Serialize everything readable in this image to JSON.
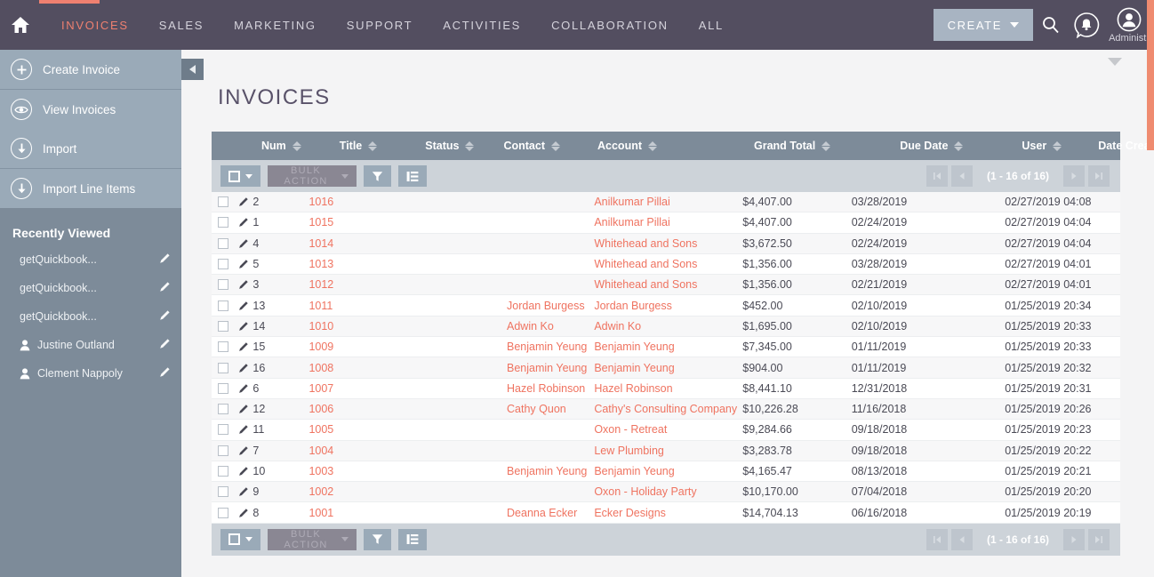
{
  "topnav": {
    "home_icon": "home-icon",
    "items": [
      {
        "label": "INVOICES",
        "active": true
      },
      {
        "label": "SALES",
        "active": false
      },
      {
        "label": "MARKETING",
        "active": false
      },
      {
        "label": "SUPPORT",
        "active": false
      },
      {
        "label": "ACTIVITIES",
        "active": false
      },
      {
        "label": "COLLABORATION",
        "active": false
      },
      {
        "label": "ALL",
        "active": false
      }
    ],
    "create_label": "CREATE",
    "search_icon": "search-icon",
    "notification_icon": "bell-icon",
    "user_icon": "user-avatar-icon",
    "user_name": "Administr"
  },
  "sidebar": {
    "actions": [
      {
        "label": "Create Invoice",
        "icon": "plus-circle-icon"
      },
      {
        "label": "View Invoices",
        "icon": "eye-circle-icon"
      },
      {
        "label": "Import",
        "icon": "download-circle-icon"
      },
      {
        "label": "Import Line Items",
        "icon": "download-circle-icon"
      }
    ],
    "recently_viewed_title": "Recently Viewed",
    "recent": [
      {
        "label": "getQuickbook...",
        "icon": null
      },
      {
        "label": "getQuickbook...",
        "icon": null
      },
      {
        "label": "getQuickbook...",
        "icon": null
      },
      {
        "label": "Justine Outland",
        "icon": "person-icon"
      },
      {
        "label": "Clement Nappoly",
        "icon": "person-icon"
      }
    ],
    "collapse_icon": "collapse-left-icon"
  },
  "main": {
    "title": "INVOICES",
    "toolbar": {
      "select_all_icon": "checkbox-dropdown-icon",
      "bulk_action_label": "BULK ACTION",
      "filter_icon": "funnel-icon",
      "columns_icon": "list-columns-icon"
    },
    "pagination": {
      "first_icon": "first-page-icon",
      "prev_icon": "prev-page-icon",
      "count_label": "(1 - 16 of 16)",
      "next_icon": "next-page-icon",
      "last_icon": "last-page-icon"
    },
    "columns": [
      {
        "key": "num",
        "label": "Num",
        "sorted": false
      },
      {
        "key": "title",
        "label": "Title",
        "sorted": false
      },
      {
        "key": "status",
        "label": "Status",
        "sorted": false
      },
      {
        "key": "contact",
        "label": "Contact",
        "sorted": false
      },
      {
        "key": "account",
        "label": "Account",
        "sorted": false
      },
      {
        "key": "grand_total",
        "label": "Grand Total",
        "sorted": false
      },
      {
        "key": "due_date",
        "label": "Due Date",
        "sorted": false
      },
      {
        "key": "user",
        "label": "User",
        "sorted": false
      },
      {
        "key": "date_created",
        "label": "Date Created",
        "sorted": true
      }
    ],
    "rows": [
      {
        "num": "2",
        "title": "1016",
        "status": "",
        "contact": "",
        "account": "Anilkumar Pillai",
        "grand_total": "$4,407.00",
        "due_date": "03/28/2019",
        "user": "",
        "date_created": "02/27/2019 04:08"
      },
      {
        "num": "1",
        "title": "1015",
        "status": "",
        "contact": "",
        "account": "Anilkumar Pillai",
        "grand_total": "$4,407.00",
        "due_date": "02/24/2019",
        "user": "",
        "date_created": "02/27/2019 04:04"
      },
      {
        "num": "4",
        "title": "1014",
        "status": "",
        "contact": "",
        "account": "Whitehead and Sons",
        "grand_total": "$3,672.50",
        "due_date": "02/24/2019",
        "user": "",
        "date_created": "02/27/2019 04:04"
      },
      {
        "num": "5",
        "title": "1013",
        "status": "",
        "contact": "",
        "account": "Whitehead and Sons",
        "grand_total": "$1,356.00",
        "due_date": "03/28/2019",
        "user": "",
        "date_created": "02/27/2019 04:01"
      },
      {
        "num": "3",
        "title": "1012",
        "status": "",
        "contact": "",
        "account": "Whitehead and Sons",
        "grand_total": "$1,356.00",
        "due_date": "02/21/2019",
        "user": "",
        "date_created": "02/27/2019 04:01"
      },
      {
        "num": "13",
        "title": "1011",
        "status": "",
        "contact": "Jordan Burgess",
        "account": "Jordan Burgess",
        "grand_total": "$452.00",
        "due_date": "02/10/2019",
        "user": "",
        "date_created": "01/25/2019 20:34"
      },
      {
        "num": "14",
        "title": "1010",
        "status": "",
        "contact": "Adwin Ko",
        "account": "Adwin Ko",
        "grand_total": "$1,695.00",
        "due_date": "02/10/2019",
        "user": "",
        "date_created": "01/25/2019 20:33"
      },
      {
        "num": "15",
        "title": "1009",
        "status": "",
        "contact": "Benjamin Yeung",
        "account": "Benjamin Yeung",
        "grand_total": "$7,345.00",
        "due_date": "01/11/2019",
        "user": "",
        "date_created": "01/25/2019 20:33"
      },
      {
        "num": "16",
        "title": "1008",
        "status": "",
        "contact": "Benjamin Yeung",
        "account": "Benjamin Yeung",
        "grand_total": "$904.00",
        "due_date": "01/11/2019",
        "user": "",
        "date_created": "01/25/2019 20:32"
      },
      {
        "num": "6",
        "title": "1007",
        "status": "",
        "contact": "Hazel Robinson",
        "account": "Hazel Robinson",
        "grand_total": "$8,441.10",
        "due_date": "12/31/2018",
        "user": "",
        "date_created": "01/25/2019 20:31"
      },
      {
        "num": "12",
        "title": "1006",
        "status": "",
        "contact": "Cathy Quon",
        "account": "Cathy's Consulting Company",
        "grand_total": "$10,226.28",
        "due_date": "11/16/2018",
        "user": "",
        "date_created": "01/25/2019 20:26"
      },
      {
        "num": "11",
        "title": "1005",
        "status": "",
        "contact": "",
        "account": "Oxon - Retreat",
        "grand_total": "$9,284.66",
        "due_date": "09/18/2018",
        "user": "",
        "date_created": "01/25/2019 20:23"
      },
      {
        "num": "7",
        "title": "1004",
        "status": "",
        "contact": "",
        "account": "Lew Plumbing",
        "grand_total": "$3,283.78",
        "due_date": "09/18/2018",
        "user": "",
        "date_created": "01/25/2019 20:22"
      },
      {
        "num": "10",
        "title": "1003",
        "status": "",
        "contact": "Benjamin Yeung",
        "account": "Benjamin Yeung",
        "grand_total": "$4,165.47",
        "due_date": "08/13/2018",
        "user": "",
        "date_created": "01/25/2019 20:21"
      },
      {
        "num": "9",
        "title": "1002",
        "status": "",
        "contact": "",
        "account": "Oxon - Holiday Party",
        "grand_total": "$10,170.00",
        "due_date": "07/04/2018",
        "user": "",
        "date_created": "01/25/2019 20:20"
      },
      {
        "num": "8",
        "title": "1001",
        "status": "",
        "contact": "Deanna Ecker",
        "account": "Ecker Designs",
        "grand_total": "$14,704.13",
        "due_date": "06/16/2018",
        "user": "",
        "date_created": "01/25/2019 20:19"
      }
    ]
  },
  "colors": {
    "nav_bg": "#534e60",
    "accent": "#ef7360",
    "sidebar_bg": "#7d8b99",
    "sidebar_item_bg": "#9aaab8",
    "toolbar_bg": "#cdd3d9",
    "header_bg": "#7d8b99"
  }
}
